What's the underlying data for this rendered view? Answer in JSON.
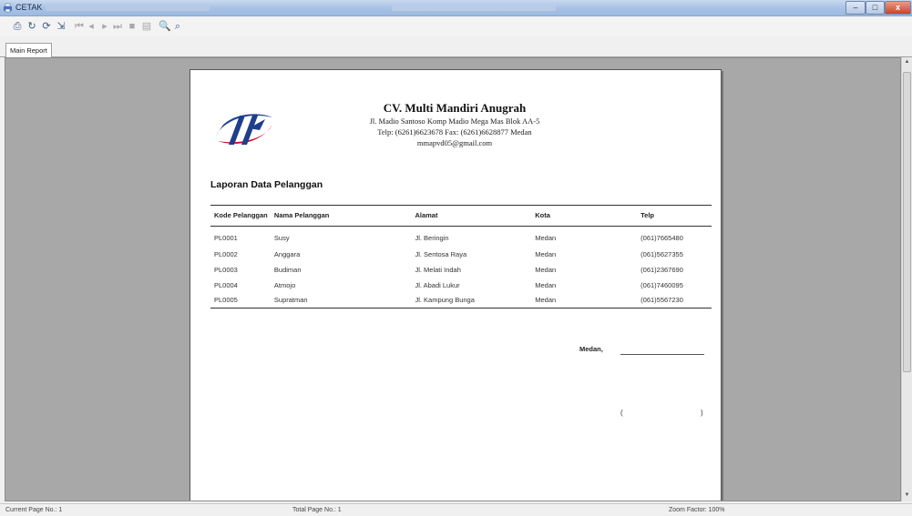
{
  "window": {
    "title": "CETAK",
    "icons": {
      "app": "printer-app-icon",
      "minimize": "minimize-icon",
      "maximize": "maximize-icon",
      "close": "close-icon"
    },
    "close_label": "x",
    "minimize_label": "–",
    "maximize_label": "□"
  },
  "toolbar": {
    "buttons": [
      {
        "name": "print-setup",
        "icon": "print-setup-icon",
        "glyph": "⎙"
      },
      {
        "name": "refresh",
        "icon": "refresh-icon",
        "glyph": "↻"
      },
      {
        "name": "refresh-all",
        "icon": "refresh-all-icon",
        "glyph": "⟳"
      },
      {
        "name": "export",
        "icon": "export-icon",
        "glyph": "⇲"
      },
      {
        "name": "first-page",
        "icon": "first-page-icon",
        "glyph": "⏮"
      },
      {
        "name": "previous-page",
        "icon": "previous-page-icon",
        "glyph": "◂"
      },
      {
        "name": "next-page",
        "icon": "next-page-icon",
        "glyph": "▸"
      },
      {
        "name": "last-page",
        "icon": "last-page-icon",
        "glyph": "⏭"
      },
      {
        "name": "stop",
        "icon": "stop-icon",
        "glyph": "■"
      },
      {
        "name": "group-tree",
        "icon": "group-tree-icon",
        "glyph": "▤"
      },
      {
        "name": "search",
        "icon": "search-icon",
        "glyph": "🔍"
      },
      {
        "name": "zoom",
        "icon": "zoom-icon",
        "glyph": "⌕"
      }
    ]
  },
  "tabs": [
    {
      "label": "Main Report",
      "active": true
    }
  ],
  "report": {
    "company_name": "CV. Multi Mandiri Anugrah",
    "company_address": "Jl. Madio Santoso Komp Madio Mega Mas Blok AA-5",
    "company_phone": "Telp: (6261)6623678 Fax: (6261)6628877 Medan",
    "company_email": "mmapvd05@gmail.com",
    "title": "Laporan Data Pelanggan",
    "columns": [
      "Kode Pelanggan",
      "Nama Pelanggan",
      "Alamat",
      "Kota",
      "Telp"
    ],
    "rows": [
      [
        "PL0001",
        "Susy",
        "Jl. Beringin",
        "Medan",
        "(061)7665480"
      ],
      [
        "PL0002",
        "Anggara",
        "Jl. Sentosa Raya",
        "Medan",
        "(061)5627355"
      ],
      [
        "PL0003",
        "Budiman",
        "Jl. Melati Indah",
        "Medan",
        "(061)2367690"
      ],
      [
        "PL0004",
        "Atmojo",
        "Jl. Abadi Lukur",
        "Medan",
        "(061)7460095"
      ],
      [
        "PL0005",
        "Supratman",
        "Jl. Kampung Bunga",
        "Medan",
        "(061)5567230"
      ]
    ],
    "sign_city": "Medan,",
    "sign_open": "(",
    "sign_close": ")",
    "colors": {
      "logo_blue": "#1f3f8c",
      "logo_red": "#c8102e"
    }
  },
  "statusbar": {
    "current_page": "Current Page No.: 1",
    "total_page": "Total Page No.: 1",
    "zoom": "Zoom Factor: 100%"
  }
}
